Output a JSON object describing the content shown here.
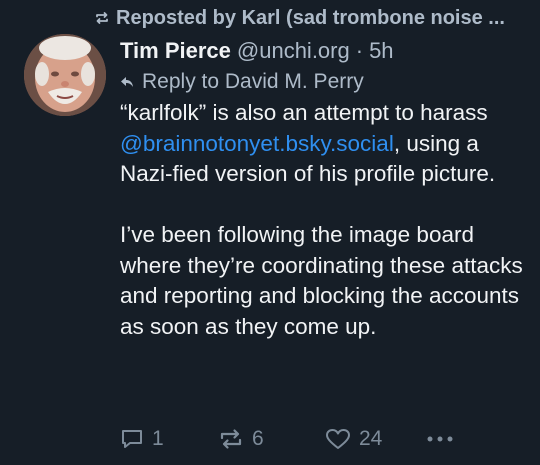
{
  "colors": {
    "background": "#161e27",
    "text": "#f1f3f5",
    "muted": "#aebbc9",
    "link": "#2f8ff0",
    "action_icon": "#7d8b99"
  },
  "repost": {
    "icon": "repost-icon",
    "text": "Reposted by Karl (sad trombone noise ..."
  },
  "author": {
    "avatar_icon": "avatar",
    "name": "Tim Pierce",
    "handle": "@unchi.org",
    "separator": "·",
    "time": "5h"
  },
  "reply": {
    "icon": "reply-arrow-icon",
    "text": "Reply to David M. Perry"
  },
  "body": {
    "p1_before": "“karlfolk” is also an attempt to harass ",
    "mention": "@brainnotonyet.bsky.social",
    "p1_after": ", using a Nazi-fied version of his profile picture.",
    "p2": "I’ve been following the image board where they’re coordinating these attacks and reporting and blocking the accounts as soon as they come up."
  },
  "actions": {
    "reply_count": "1",
    "repost_count": "6",
    "like_count": "24",
    "reply_icon": "comment-icon",
    "repost_icon": "repost-icon",
    "like_icon": "heart-icon",
    "more_icon": "more-dots-icon"
  }
}
